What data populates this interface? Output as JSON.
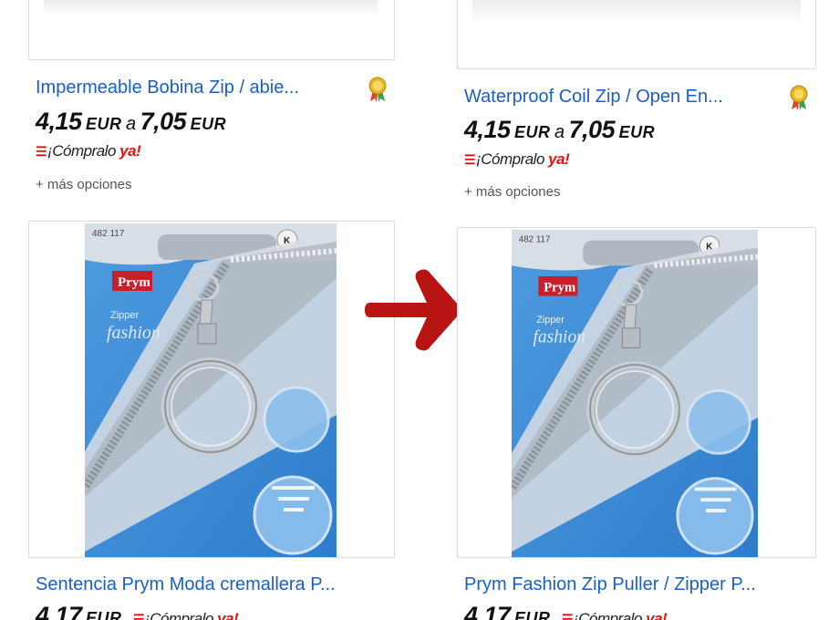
{
  "listings": [
    {
      "title": "Impermeable Bobina Zip / abie...",
      "price_low": "4,15",
      "price_high": "7,05",
      "currency": "EUR",
      "price_sep": "a",
      "buy_prefix": "¡Cómpralo ",
      "buy_ya": "ya!",
      "more_options": "+ más opciones",
      "has_badge": true
    },
    {
      "title": "Waterproof Coil Zip / Open En...",
      "price_low": "4,15",
      "price_high": "7,05",
      "currency": "EUR",
      "price_sep": "a",
      "buy_prefix": "¡Cómpralo ",
      "buy_ya": "ya!",
      "more_options": "+ más opciones",
      "has_badge": true
    },
    {
      "title": "Sentencia Prym Moda cremallera P...",
      "price_low": "4,17",
      "currency": "EUR",
      "buy_prefix": "¡Cómpralo ",
      "buy_ya": "ya!",
      "package": {
        "code": "482 117",
        "brand": "Prym",
        "line1": "Zipper",
        "line2": "fashion",
        "k": "K"
      }
    },
    {
      "title": "Prym Fashion Zip Puller / Zipper P...",
      "price_low": "4,17",
      "currency": "EUR",
      "buy_prefix": "¡Cómpralo ",
      "buy_ya": "ya!",
      "package": {
        "code": "482 117",
        "brand": "Prym",
        "line1": "Zipper",
        "line2": "fashion",
        "k": "K"
      }
    }
  ],
  "arrow": {
    "color": "#b81414"
  },
  "colors": {
    "link": "#1a5fc8",
    "buy_red": "#e01313",
    "pkg_blue": "#3f8fd6",
    "brand_red": "#c8202a"
  },
  "icons": {
    "badge": "top-rated-ribbon-icon",
    "buy": "buy-it-now-icon",
    "arrow": "right-arrow-icon"
  }
}
